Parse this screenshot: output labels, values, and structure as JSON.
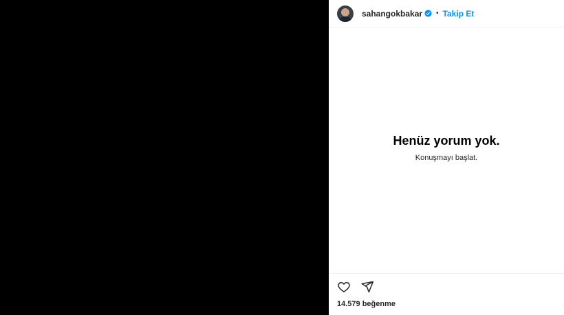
{
  "post": {
    "username": "sahangokbakar",
    "follow_label": "Takip Et",
    "separator": "•"
  },
  "comments": {
    "empty_title": "Henüz yorum yok.",
    "empty_subtitle": "Konuşmayı başlat."
  },
  "actions": {
    "like_icon": "heart-icon",
    "share_icon": "paper-plane-icon"
  },
  "likes": {
    "text": "14.579 beğenme"
  },
  "colors": {
    "accent": "#0095f6",
    "media_background": "#000000",
    "verified_badge": "#0095f6"
  }
}
